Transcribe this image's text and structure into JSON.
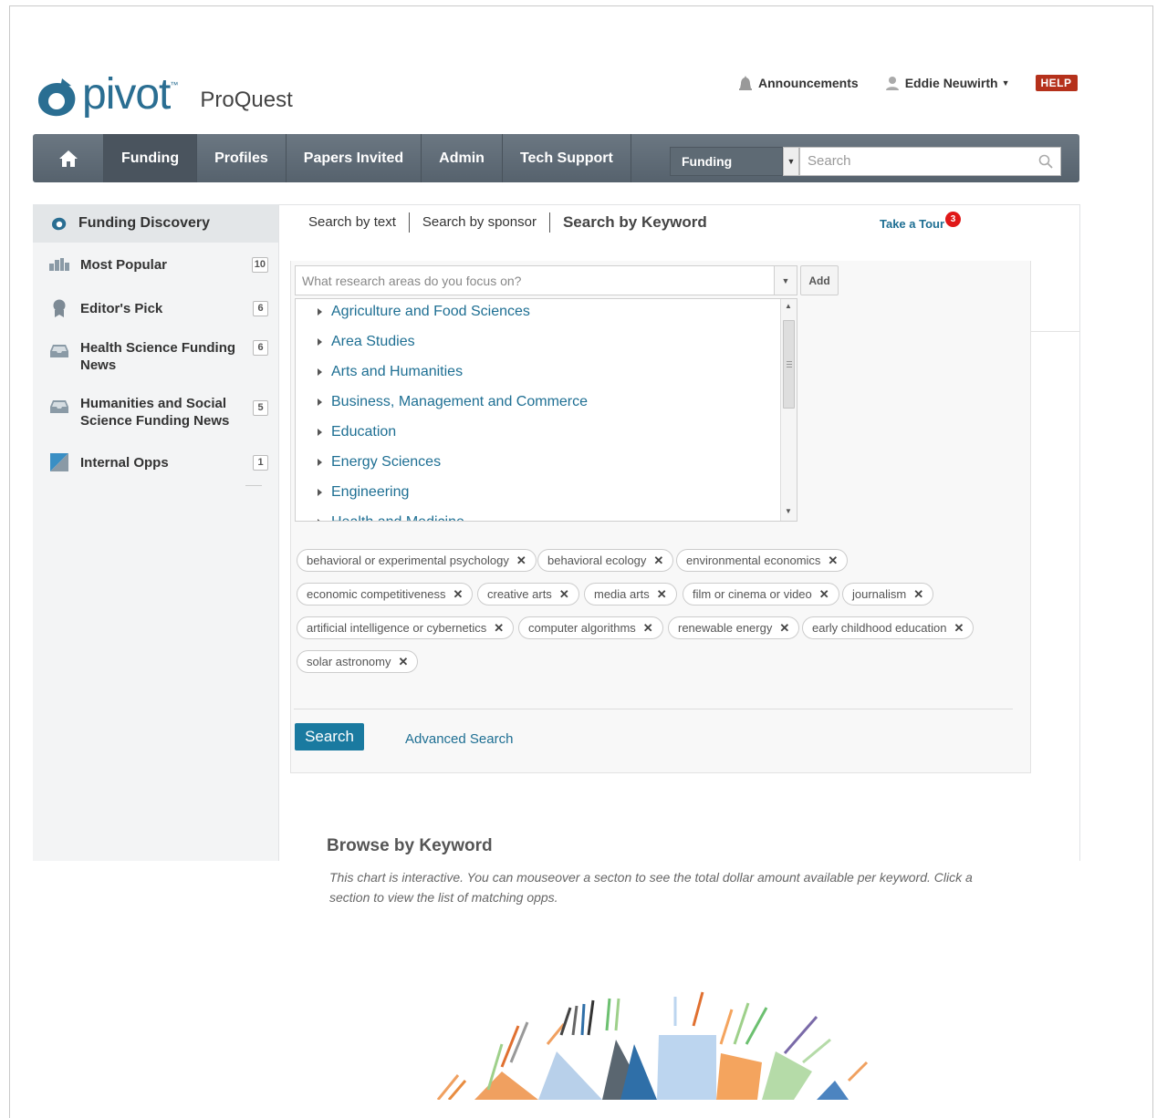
{
  "header": {
    "logo_text": "pivot",
    "logo_tm": "™",
    "brand": "ProQuest",
    "announcements": "Announcements",
    "user": "Eddie Neuwirth",
    "help": "HELP"
  },
  "nav": {
    "items": [
      {
        "label": "Funding"
      },
      {
        "label": "Profiles"
      },
      {
        "label": "Papers Invited"
      },
      {
        "label": "Admin"
      },
      {
        "label": "Tech Support"
      }
    ],
    "search_scope": "Funding",
    "search_placeholder": "Search"
  },
  "sidebar": {
    "heading": "Funding Discovery",
    "items": [
      {
        "label": "Most Popular",
        "count": "10"
      },
      {
        "label": "Editor's Pick",
        "count": "6"
      },
      {
        "label": "Health Science Funding News",
        "count": "6"
      },
      {
        "label": "Humanities and Social Science Funding News",
        "count": "5"
      },
      {
        "label": "Internal Opps",
        "count": "1"
      }
    ]
  },
  "tabs": {
    "by_text": "Search by text",
    "by_sponsor": "Search by sponsor",
    "by_keyword": "Search by Keyword",
    "tour": "Take a Tour",
    "tour_count": "3"
  },
  "keyword": {
    "placeholder": "What research areas do you focus on?",
    "add": "Add",
    "tree": [
      "Agriculture and Food Sciences",
      "Area Studies",
      "Arts and Humanities",
      "Business, Management and Commerce",
      "Education",
      "Energy Sciences",
      "Engineering",
      "Health and Medicine"
    ],
    "chips": [
      "behavioral or experimental psychology",
      "behavioral ecology",
      "environmental economics",
      "economic competitiveness",
      "creative arts",
      "media arts",
      "film or cinema or video",
      "journalism",
      "artificial intelligence or cybernetics",
      "computer algorithms",
      "renewable energy",
      "early childhood education",
      "solar astronomy"
    ]
  },
  "actions": {
    "search": "Search",
    "advanced": "Advanced Search"
  },
  "browse": {
    "title": "Browse by Keyword",
    "description": "This chart is interactive. You can mouseover a secton to see the total dollar amount available per keyword. Click a section to view the list of matching opps."
  }
}
